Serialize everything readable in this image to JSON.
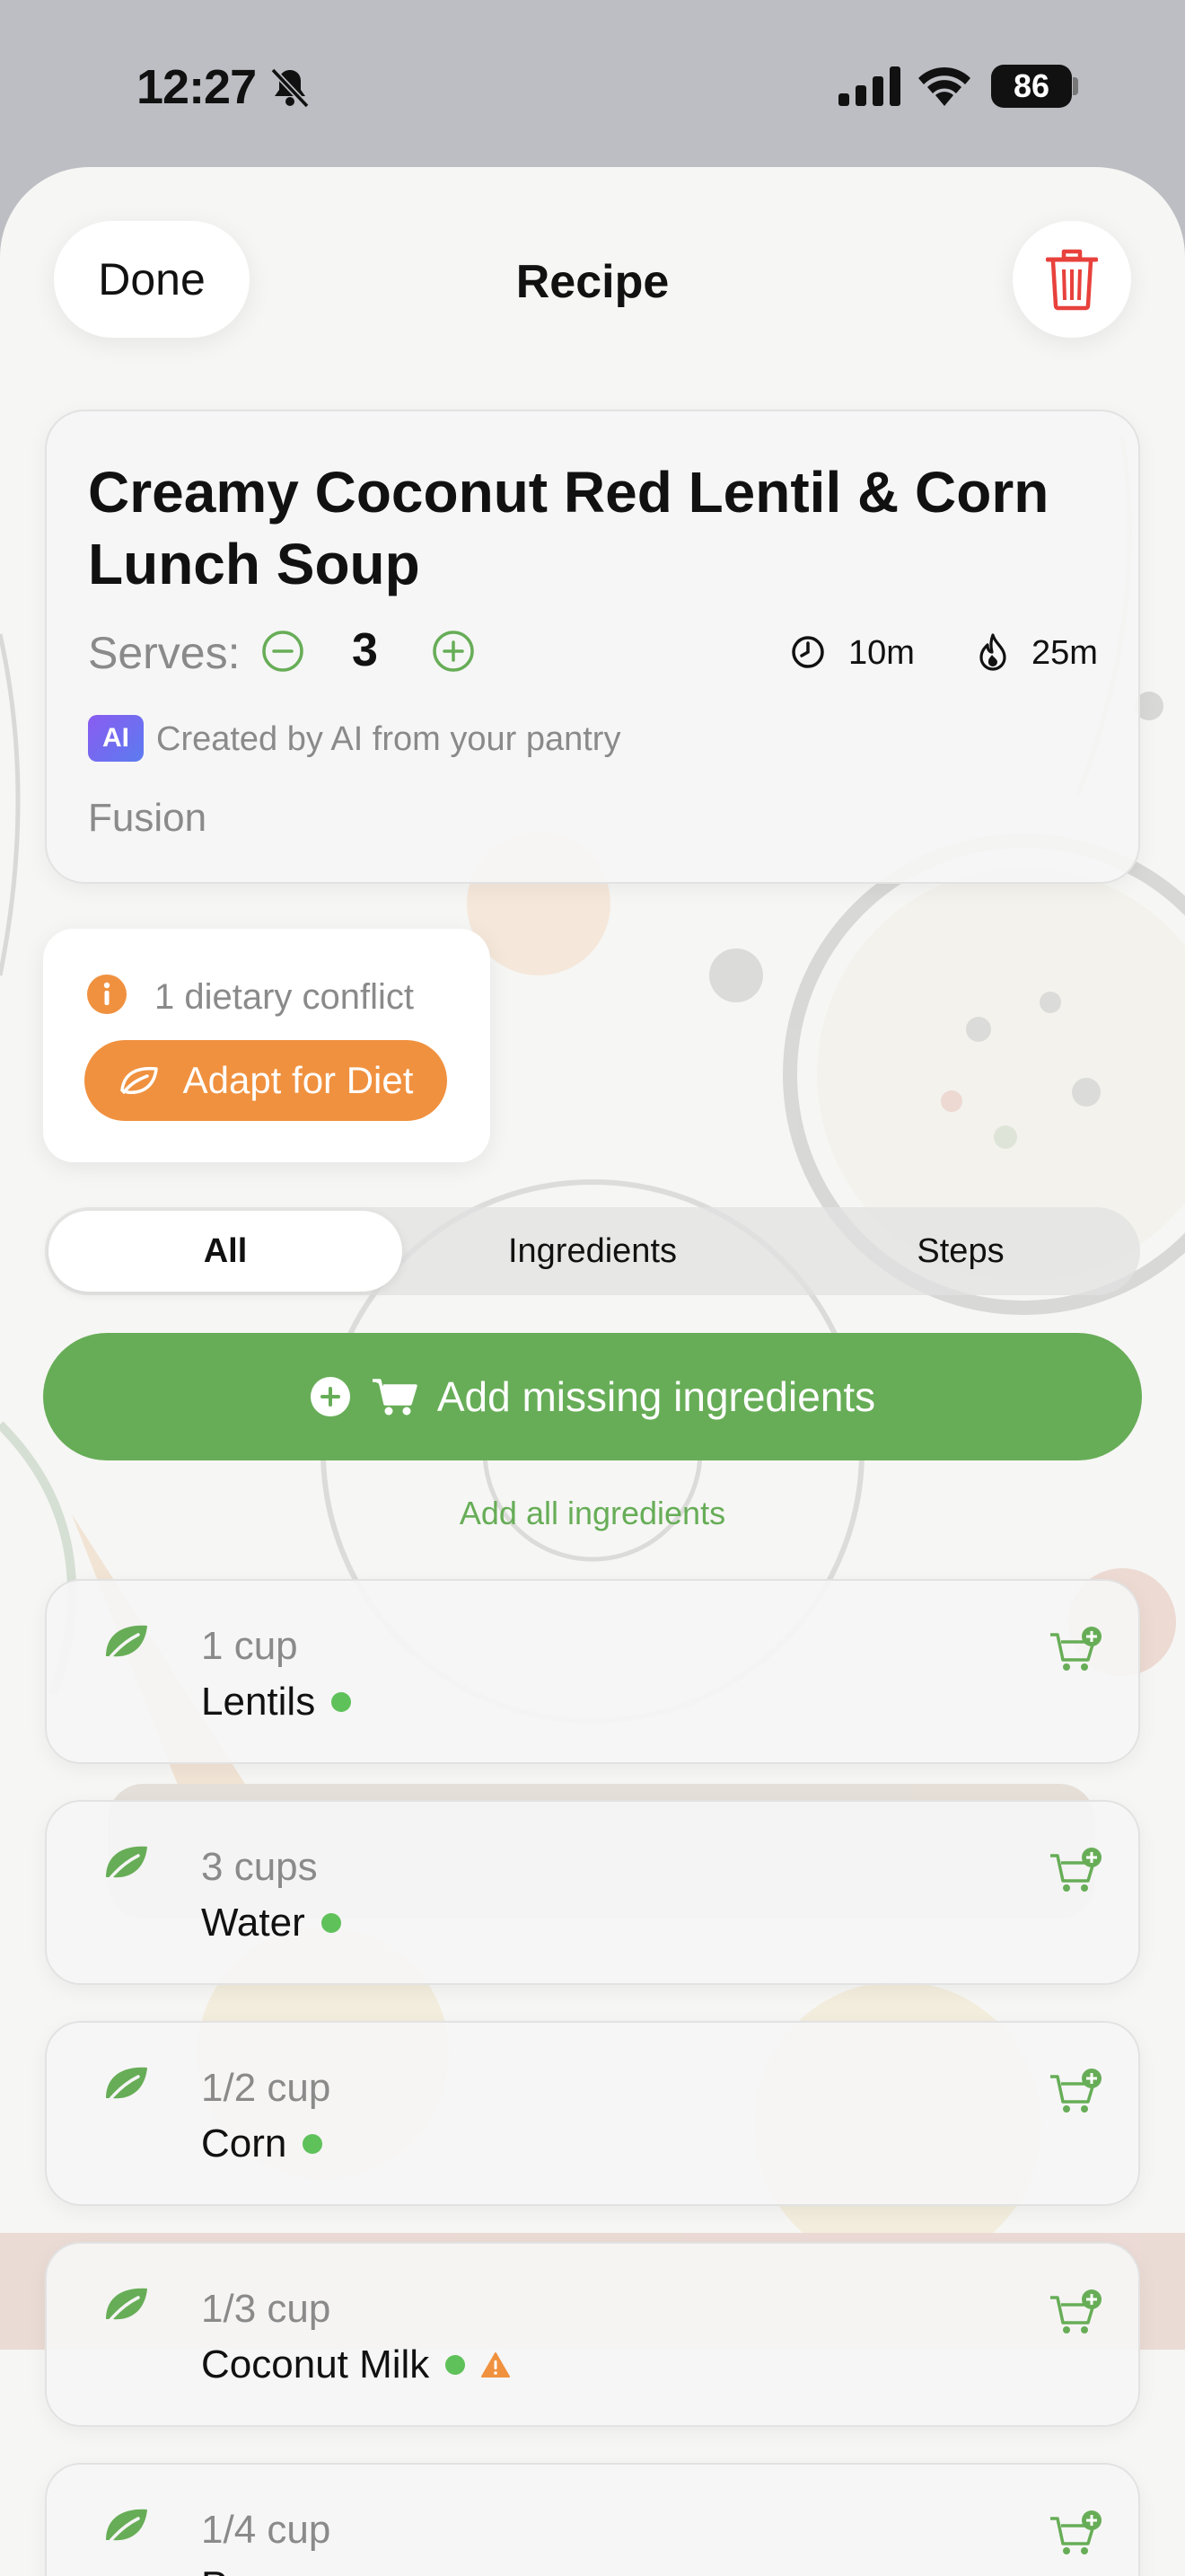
{
  "status_bar": {
    "time": "12:27",
    "battery": "86"
  },
  "nav": {
    "done_label": "Done",
    "title": "Recipe"
  },
  "recipe": {
    "title": "Creamy Coconut Red Lentil & Corn Lunch Soup",
    "serves_label": "Serves:",
    "serves": "3",
    "prep_time": "10m",
    "cook_time": "25m",
    "ai_badge": "AI",
    "ai_note": "Created by AI from your pantry",
    "cuisine": "Fusion"
  },
  "diet": {
    "conflict_text": "1 dietary conflict",
    "adapt_label": "Adapt for Diet"
  },
  "tabs": [
    {
      "label": "All",
      "selected": true
    },
    {
      "label": "Ingredients",
      "selected": false
    },
    {
      "label": "Steps",
      "selected": false
    }
  ],
  "actions": {
    "add_missing_label": "Add missing ingredients",
    "add_all_label": "Add all ingredients"
  },
  "ingredients": [
    {
      "qty": "1 cup",
      "name": "Lentils",
      "in_pantry": true,
      "warning": false
    },
    {
      "qty": "3 cups",
      "name": "Water",
      "in_pantry": true,
      "warning": false
    },
    {
      "qty": "1/2 cup",
      "name": "Corn",
      "in_pantry": true,
      "warning": false
    },
    {
      "qty": "1/3 cup",
      "name": "Coconut Milk",
      "in_pantry": true,
      "warning": true
    },
    {
      "qty": "1/4 cup",
      "name": "Peas",
      "in_pantry": true,
      "warning": false
    }
  ],
  "colors": {
    "accent_green": "#67ad57",
    "accent_orange": "#f0913f",
    "delete_red": "#e8413c",
    "pantry_dot": "#5fc15a"
  }
}
